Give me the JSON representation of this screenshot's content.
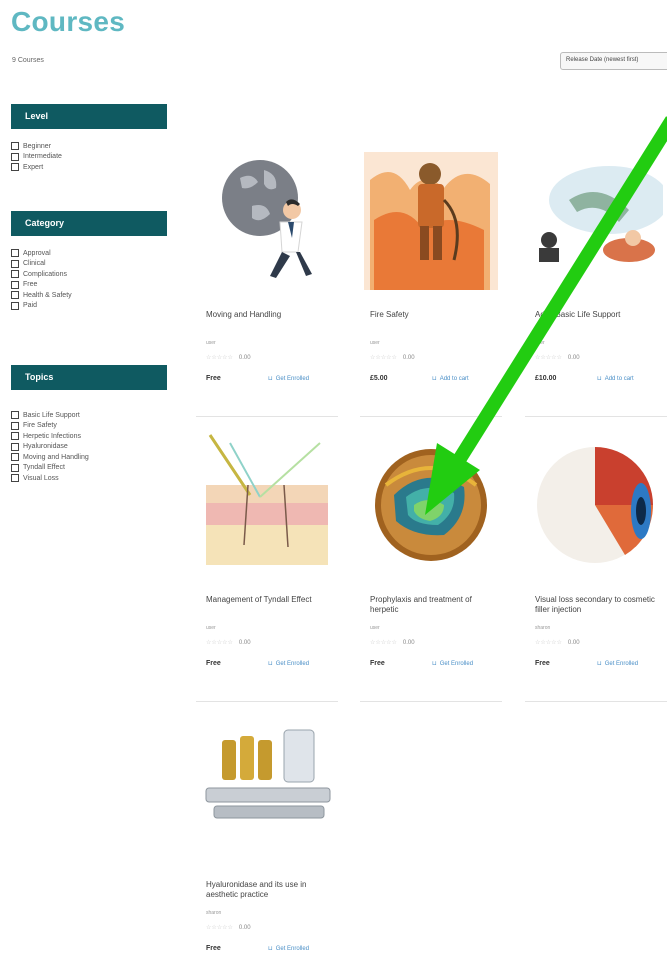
{
  "page": {
    "title": "Courses",
    "count": "9 Courses",
    "sort": "Release Date (newest first)"
  },
  "filters": [
    {
      "title": "Level",
      "options": [
        "Beginner",
        "Intermediate",
        "Expert"
      ]
    },
    {
      "title": "Category",
      "options": [
        "Approval",
        "Clinical",
        "Complications",
        "Free",
        "Health & Safety",
        "Paid"
      ]
    },
    {
      "title": "Topics",
      "options": [
        "Basic Life Support",
        "Fire Safety",
        "Herpetic Infections",
        "Hyaluronidase",
        "Moving and Handling",
        "Tyndall Effect",
        "Visual Loss"
      ]
    }
  ],
  "courses": [
    {
      "title": "Moving and Handling",
      "author": "user",
      "rating": "0.00",
      "price": "Free",
      "action": "Get Enrolled",
      "icon": "globe-carrier-illustration"
    },
    {
      "title": "Fire Safety",
      "author": "user",
      "rating": "0.00",
      "price": "£5.00",
      "action": "Add to cart",
      "icon": "firefighter-illustration"
    },
    {
      "title": "Adult Basic Life Support",
      "author": "user",
      "rating": "0.00",
      "price": "£10.00",
      "action": "Add to cart",
      "icon": "cpr-illustration"
    },
    {
      "title": "Management of Tyndall Effect",
      "author": "user",
      "rating": "0.00",
      "price": "Free",
      "action": "Get Enrolled",
      "icon": "skin-layers-illustration"
    },
    {
      "title": "Prophylaxis and treatment of herpetic",
      "author": "user",
      "rating": "0.00",
      "price": "Free",
      "action": "Get Enrolled",
      "icon": "virus-cell-illustration"
    },
    {
      "title": "Visual loss secondary to cosmetic filler injection",
      "author": "sharon",
      "rating": "0.00",
      "price": "Free",
      "action": "Get Enrolled",
      "icon": "eye-cross-section-illustration"
    },
    {
      "title": "Hyaluronidase and its use in aesthetic practice",
      "author": "sharon",
      "rating": "0.00",
      "price": "Free",
      "action": "Get Enrolled",
      "icon": "syringe-vials-illustration"
    }
  ],
  "overlay": {
    "arrow_color": "#22cc11"
  }
}
